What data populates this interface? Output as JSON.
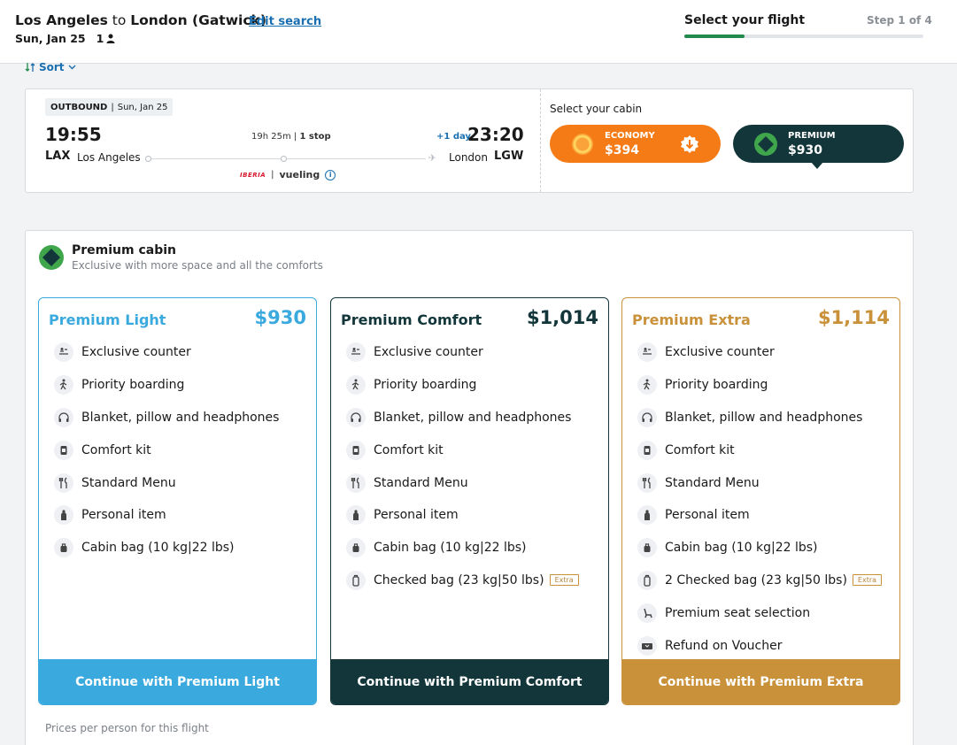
{
  "header": {
    "origin": "Los Angeles",
    "to_word": "to",
    "destination": "London (Gatwick)",
    "edit_label": "Edit search",
    "date": "Sun, Jan 25",
    "passengers": "1",
    "step_title": "Select your flight",
    "step_count": "Step 1 of 4",
    "step_progress": 0.25
  },
  "sort": {
    "label": "Sort"
  },
  "flight": {
    "direction": "OUTBOUND",
    "date": "Sun, Jan 25",
    "dep_time": "19:55",
    "dep_code": "LAX",
    "dep_city": "Los Angeles",
    "duration": "19h 25m",
    "stops": "1 stop",
    "arr_time": "23:20",
    "arr_code": "LGW",
    "arr_city": "London",
    "plus_day": "+1 day",
    "airline_1": "IBERIA",
    "airline_2": "vueling",
    "info_glyph": "i"
  },
  "cabin_select": {
    "label": "Select your cabin",
    "economy": {
      "name": "ECONOMY",
      "price": "$394"
    },
    "premium": {
      "name": "PREMIUM",
      "price": "$930"
    }
  },
  "panel": {
    "title": "Premium cabin",
    "subtitle": "Exclusive with more space and all the comforts",
    "prices_note": "Prices per person for this flight",
    "extra_badge": "Extra",
    "colors": {
      "light": "#3aa9de",
      "comfort": "#12363a",
      "extra": "#c9913a",
      "economy": "#f47b16"
    }
  },
  "fares": {
    "light": {
      "name": "Premium Light",
      "price": "$930",
      "cta": "Continue with Premium Light",
      "features": [
        {
          "icon": "counter-icon",
          "label": "Exclusive counter"
        },
        {
          "icon": "boarding-icon",
          "label": "Priority boarding"
        },
        {
          "icon": "headphones-icon",
          "label": "Blanket, pillow and headphones"
        },
        {
          "icon": "comfort-kit-icon",
          "label": "Comfort kit"
        },
        {
          "icon": "menu-icon",
          "label": "Standard Menu"
        },
        {
          "icon": "personal-item-icon",
          "label": "Personal item"
        },
        {
          "icon": "cabin-bag-icon",
          "label": "Cabin bag (10 kg|22 lbs)"
        }
      ]
    },
    "comfort": {
      "name": "Premium Comfort",
      "price": "$1,014",
      "cta": "Continue with Premium Comfort",
      "features": [
        {
          "icon": "counter-icon",
          "label": "Exclusive counter"
        },
        {
          "icon": "boarding-icon",
          "label": "Priority boarding"
        },
        {
          "icon": "headphones-icon",
          "label": "Blanket, pillow and headphones"
        },
        {
          "icon": "comfort-kit-icon",
          "label": "Comfort kit"
        },
        {
          "icon": "menu-icon",
          "label": "Standard Menu"
        },
        {
          "icon": "personal-item-icon",
          "label": "Personal item"
        },
        {
          "icon": "cabin-bag-icon",
          "label": "Cabin bag (10 kg|22 lbs)"
        },
        {
          "icon": "checked-bag-icon",
          "label": "Checked bag (23 kg|50 lbs)",
          "extra": true
        }
      ]
    },
    "extra": {
      "name": "Premium Extra",
      "price": "$1,114",
      "cta": "Continue with Premium Extra",
      "features": [
        {
          "icon": "counter-icon",
          "label": "Exclusive counter"
        },
        {
          "icon": "boarding-icon",
          "label": "Priority boarding"
        },
        {
          "icon": "headphones-icon",
          "label": "Blanket, pillow and headphones"
        },
        {
          "icon": "comfort-kit-icon",
          "label": "Comfort kit"
        },
        {
          "icon": "menu-icon",
          "label": "Standard Menu"
        },
        {
          "icon": "personal-item-icon",
          "label": "Personal item"
        },
        {
          "icon": "cabin-bag-icon",
          "label": "Cabin bag (10 kg|22 lbs)"
        },
        {
          "icon": "checked-bag-icon",
          "label": "2 Checked bag (23 kg|50 lbs)",
          "extra": true
        },
        {
          "icon": "seat-icon",
          "label": "Premium seat selection"
        },
        {
          "icon": "voucher-icon",
          "label": "Refund on Voucher"
        }
      ]
    }
  }
}
